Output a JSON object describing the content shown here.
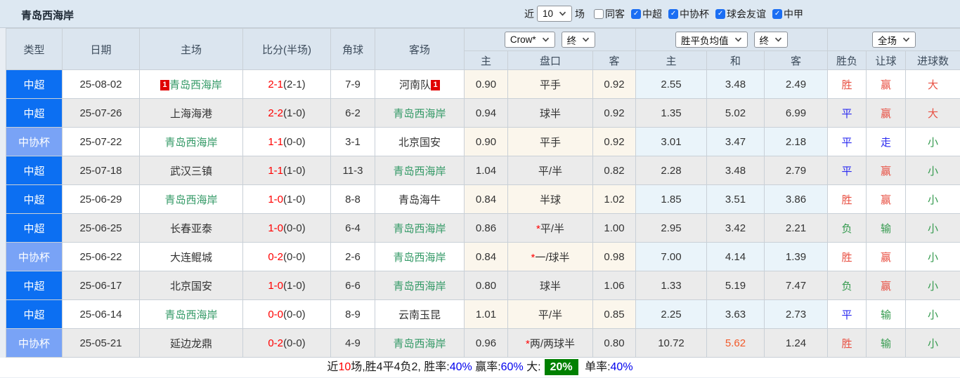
{
  "topbar": {
    "title": "青岛西海岸",
    "recent_label": "近",
    "recent_value": "10",
    "matches_label": "场",
    "checks": [
      {
        "label": "同客",
        "checked": false
      },
      {
        "label": "中超",
        "checked": true
      },
      {
        "label": "中协杯",
        "checked": true
      },
      {
        "label": "球会友谊",
        "checked": true
      },
      {
        "label": "中甲",
        "checked": true
      }
    ]
  },
  "header": {
    "static_columns": [
      "类型",
      "日期",
      "主场",
      "比分(半场)",
      "角球",
      "客场"
    ],
    "bookmaker_select": "Crow*",
    "handicap_time_select": "终",
    "odds_type_select": "胜平负均值",
    "odds_time_select": "终",
    "scope_select": "全场",
    "sub_columns": [
      "主",
      "盘口",
      "客",
      "主",
      "和",
      "客",
      "胜负",
      "让球",
      "进球数"
    ]
  },
  "rows": [
    {
      "type": "中超",
      "tcls": "t-lg",
      "date": "25-08-02",
      "hbadge": "1",
      "home": "青岛西海岸",
      "hcls": "team-g",
      "ft": "2-1",
      "ht": "(2-1)",
      "corners": "7-9",
      "away": "河南队",
      "abadge": "1",
      "acls": "team-d",
      "ah": "0.90",
      "star": "",
      "handi": "平手",
      "aa": "0.92",
      "oh": "2.55",
      "od": "3.48",
      "odcls": "",
      "oa": "2.49",
      "wdl": "胜",
      "wdlc": "c-r",
      "letv": "赢",
      "letc": "c-r",
      "goal": "大",
      "goalc": "c-r"
    },
    {
      "type": "中超",
      "tcls": "t-lg",
      "date": "25-07-26",
      "hbadge": "",
      "home": "上海海港",
      "hcls": "team-d",
      "ft": "2-2",
      "ht": "(1-0)",
      "corners": "6-2",
      "away": "青岛西海岸",
      "abadge": "",
      "acls": "team-g",
      "ah": "0.94",
      "star": "",
      "handi": "球半",
      "aa": "0.92",
      "oh": "1.35",
      "od": "5.02",
      "odcls": "",
      "oa": "6.99",
      "wdl": "平",
      "wdlc": "c-b",
      "letv": "赢",
      "letc": "c-r",
      "goal": "大",
      "goalc": "c-r"
    },
    {
      "type": "中协杯",
      "tcls": "t-cup",
      "date": "25-07-22",
      "hbadge": "",
      "home": "青岛西海岸",
      "hcls": "team-g",
      "ft": "1-1",
      "ht": "(0-0)",
      "corners": "3-1",
      "away": "北京国安",
      "abadge": "",
      "acls": "team-d",
      "ah": "0.90",
      "star": "",
      "handi": "平手",
      "aa": "0.92",
      "oh": "3.01",
      "od": "3.47",
      "odcls": "",
      "oa": "2.18",
      "wdl": "平",
      "wdlc": "c-b",
      "letv": "走",
      "letc": "c-b",
      "goal": "小",
      "goalc": "c-g"
    },
    {
      "type": "中超",
      "tcls": "t-lg",
      "date": "25-07-18",
      "hbadge": "",
      "home": "武汉三镇",
      "hcls": "team-d",
      "ft": "1-1",
      "ht": "(1-0)",
      "corners": "11-3",
      "away": "青岛西海岸",
      "abadge": "",
      "acls": "team-g",
      "ah": "1.04",
      "star": "",
      "handi": "平/半",
      "aa": "0.82",
      "oh": "2.28",
      "od": "3.48",
      "odcls": "",
      "oa": "2.79",
      "wdl": "平",
      "wdlc": "c-b",
      "letv": "赢",
      "letc": "c-r",
      "goal": "小",
      "goalc": "c-g"
    },
    {
      "type": "中超",
      "tcls": "t-lg",
      "date": "25-06-29",
      "hbadge": "",
      "home": "青岛西海岸",
      "hcls": "team-g",
      "ft": "1-0",
      "ht": "(1-0)",
      "corners": "8-8",
      "away": "青岛海牛",
      "abadge": "",
      "acls": "team-d",
      "ah": "0.84",
      "star": "",
      "handi": "半球",
      "aa": "1.02",
      "oh": "1.85",
      "od": "3.51",
      "odcls": "",
      "oa": "3.86",
      "wdl": "胜",
      "wdlc": "c-r",
      "letv": "赢",
      "letc": "c-r",
      "goal": "小",
      "goalc": "c-g"
    },
    {
      "type": "中超",
      "tcls": "t-lg",
      "date": "25-06-25",
      "hbadge": "",
      "home": "长春亚泰",
      "hcls": "team-d",
      "ft": "1-0",
      "ht": "(0-0)",
      "corners": "6-4",
      "away": "青岛西海岸",
      "abadge": "",
      "acls": "team-g",
      "ah": "0.86",
      "star": "*",
      "handi": "平/半",
      "aa": "1.00",
      "oh": "2.95",
      "od": "3.42",
      "odcls": "",
      "oa": "2.21",
      "wdl": "负",
      "wdlc": "c-g",
      "letv": "输",
      "letc": "c-g",
      "goal": "小",
      "goalc": "c-g"
    },
    {
      "type": "中协杯",
      "tcls": "t-cup",
      "date": "25-06-22",
      "hbadge": "",
      "home": "大连鲲城",
      "hcls": "team-d",
      "ft": "0-2",
      "ht": "(0-0)",
      "corners": "2-6",
      "away": "青岛西海岸",
      "abadge": "",
      "acls": "team-g",
      "ah": "0.84",
      "star": "*",
      "handi": "一/球半",
      "aa": "0.98",
      "oh": "7.00",
      "od": "4.14",
      "odcls": "",
      "oa": "1.39",
      "wdl": "胜",
      "wdlc": "c-r",
      "letv": "赢",
      "letc": "c-r",
      "goal": "小",
      "goalc": "c-g"
    },
    {
      "type": "中超",
      "tcls": "t-lg",
      "date": "25-06-17",
      "hbadge": "",
      "home": "北京国安",
      "hcls": "team-d",
      "ft": "1-0",
      "ht": "(1-0)",
      "corners": "6-6",
      "away": "青岛西海岸",
      "abadge": "",
      "acls": "team-g",
      "ah": "0.80",
      "star": "",
      "handi": "球半",
      "aa": "1.06",
      "oh": "1.33",
      "od": "5.19",
      "odcls": "",
      "oa": "7.47",
      "wdl": "负",
      "wdlc": "c-g",
      "letv": "赢",
      "letc": "c-r",
      "goal": "小",
      "goalc": "c-g"
    },
    {
      "type": "中超",
      "tcls": "t-lg",
      "date": "25-06-14",
      "hbadge": "",
      "home": "青岛西海岸",
      "hcls": "team-g",
      "ft": "0-0",
      "ht": "(0-0)",
      "corners": "8-9",
      "away": "云南玉昆",
      "abadge": "",
      "acls": "team-d",
      "ah": "1.01",
      "star": "",
      "handi": "平/半",
      "aa": "0.85",
      "oh": "2.25",
      "od": "3.63",
      "odcls": "",
      "oa": "2.73",
      "wdl": "平",
      "wdlc": "c-b",
      "letv": "输",
      "letc": "c-g",
      "goal": "小",
      "goalc": "c-g"
    },
    {
      "type": "中协杯",
      "tcls": "t-cup",
      "date": "25-05-21",
      "hbadge": "",
      "home": "延边龙鼎",
      "hcls": "team-d",
      "ft": "0-2",
      "ht": "(0-0)",
      "corners": "4-9",
      "away": "青岛西海岸",
      "abadge": "",
      "acls": "team-g",
      "ah": "0.96",
      "star": "*",
      "handi": "两/两球半",
      "aa": "0.80",
      "oh": "10.72",
      "od": "5.62",
      "odcls": "hot",
      "oa": "1.24",
      "wdl": "胜",
      "wdlc": "c-r",
      "letv": "输",
      "letc": "c-g",
      "goal": "小",
      "goalc": "c-g"
    }
  ],
  "summary": {
    "segments": [
      {
        "text": "近",
        "cls": "d"
      },
      {
        "text": "10",
        "cls": "r"
      },
      {
        "text": "场,胜4平4负2, 胜率:",
        "cls": "d"
      },
      {
        "text": "40%",
        "cls": "b"
      },
      {
        "text": " 赢率:",
        "cls": "d"
      },
      {
        "text": "60%",
        "cls": "b"
      },
      {
        "text": " 大:",
        "cls": "d"
      },
      {
        "text": "20%",
        "cls": "g"
      },
      {
        "text": " 单率:",
        "cls": "d"
      },
      {
        "text": "40%",
        "cls": "b"
      }
    ]
  },
  "colors": {
    "league_badge": "#0c6ff2",
    "cup_badge": "#79a3f6",
    "team_highlight": "#339966",
    "score_red": "#ff0000",
    "win_red": "#e85043",
    "draw_blue": "#2a2af0",
    "loss_green": "#349a4e",
    "hot_orange": "#f25a2a",
    "summary_badge_green": "#008000"
  }
}
